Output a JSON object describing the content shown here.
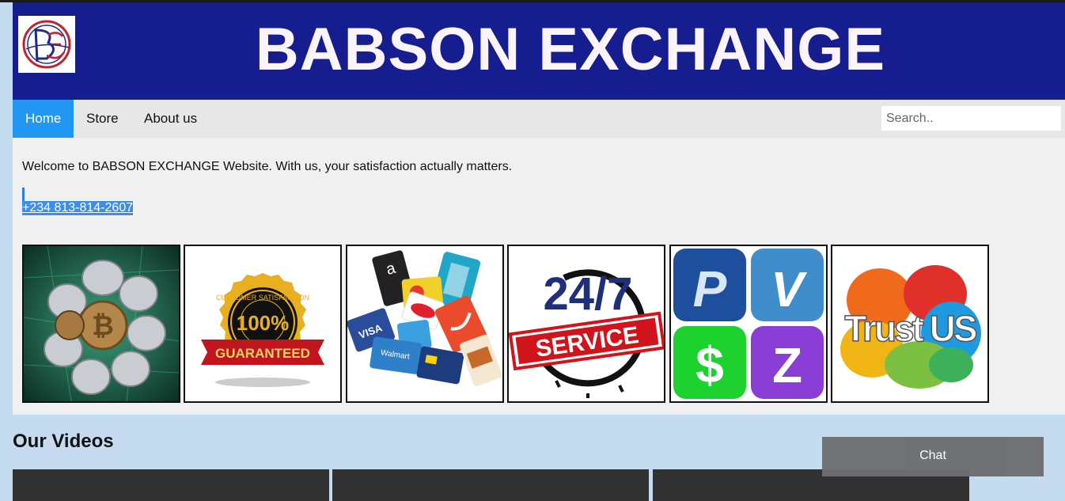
{
  "header": {
    "title": "BABSON EXCHANGE",
    "logo_icon": "babson-monogram-logo",
    "background": "#151d8f"
  },
  "nav": {
    "items": [
      {
        "label": "Home",
        "active": true
      },
      {
        "label": "Store",
        "active": false
      },
      {
        "label": "About us",
        "active": false
      }
    ],
    "search_placeholder": "Search..",
    "active_color": "#2196f3"
  },
  "main": {
    "welcome": "Welcome to BABSON EXCHANGE Website. With us, your satisfaction actually matters.",
    "phone": "+234 813-814-2607",
    "tiles": [
      {
        "icon": "crypto-coins-image"
      },
      {
        "icon": "guarantee-badge-image",
        "seal_text": "CUSTOMER SATISFACTION",
        "percent": "100%",
        "ribbon": "GUARANTEED"
      },
      {
        "icon": "gift-cards-image",
        "card_labels": [
          "VISA",
          "Walmart"
        ]
      },
      {
        "icon": "24-7-service-image",
        "number": "24/7",
        "banner": "SERVICE"
      },
      {
        "icon": "payment-apps-image",
        "apps": [
          "P",
          "V",
          "$",
          "Z"
        ]
      },
      {
        "icon": "trust-us-image",
        "text": "Trust US"
      }
    ]
  },
  "videos": {
    "title": "Our Videos"
  },
  "chat": {
    "label": "Chat"
  }
}
